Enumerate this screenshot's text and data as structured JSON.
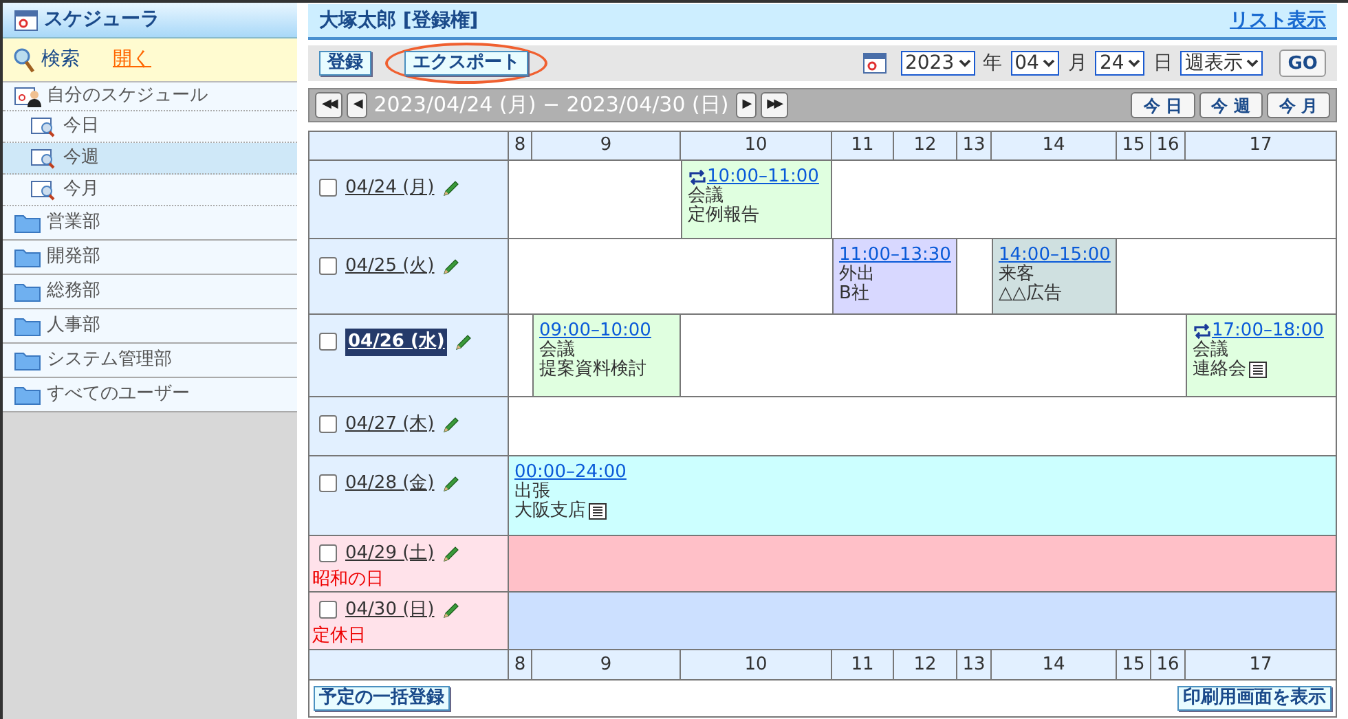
{
  "sidebar": {
    "title": "スケジューラ",
    "search_label": "検索",
    "open_label": "開く",
    "items": [
      {
        "label": "自分のスケジュール",
        "kind": "schedule",
        "children": [
          {
            "label": "今日",
            "selected": false
          },
          {
            "label": "今週",
            "selected": true
          },
          {
            "label": "今月",
            "selected": false
          }
        ]
      },
      {
        "label": "営業部",
        "kind": "folder"
      },
      {
        "label": "開発部",
        "kind": "folder"
      },
      {
        "label": "総務部",
        "kind": "folder"
      },
      {
        "label": "人事部",
        "kind": "folder"
      },
      {
        "label": "システム管理部",
        "kind": "folder"
      },
      {
        "label": "すべてのユーザー",
        "kind": "folder"
      }
    ]
  },
  "header": {
    "title": "大塚太郎 [登録権]",
    "list_link": "リスト表示"
  },
  "toolbar": {
    "buttons": [
      {
        "label": "登録",
        "highlighted": false
      },
      {
        "label": "エクスポート",
        "highlighted": true
      }
    ],
    "year": "2023",
    "year_unit": "年",
    "month": "04",
    "month_unit": "月",
    "day": "24",
    "day_unit": "日",
    "view": "週表示",
    "go": "GO"
  },
  "nav": {
    "first": "◀◀",
    "prev": "◀",
    "range": "2023/04/24 (月) − 2023/04/30 (日)",
    "next": "▶",
    "last": "▶▶",
    "buttons": [
      "今 日",
      "今 週",
      "今 月"
    ]
  },
  "grid": {
    "hours": [
      "8",
      "9",
      "10",
      "11",
      "12",
      "13",
      "14",
      "15",
      "16",
      "17"
    ],
    "footer_hours": [
      "8",
      "9",
      "10",
      "11",
      "12",
      "13",
      "14",
      "15",
      "16",
      "17"
    ],
    "days": [
      {
        "date": "04/24 (月)",
        "checked": false,
        "selected": false,
        "kind": "weekday",
        "events": [
          {
            "time": "10:00–11:00",
            "title": "会議",
            "note": "定例報告",
            "repeat": true,
            "color": "#e0ffe0"
          }
        ]
      },
      {
        "date": "04/25 (火)",
        "checked": false,
        "selected": false,
        "kind": "weekday",
        "events": [
          {
            "time": "11:00–13:30",
            "title": "外出",
            "note": "B社",
            "color": "#d8d8ff"
          },
          {
            "time": "14:00–15:00",
            "title": "来客",
            "note": "△△広告",
            "color": "#cfe0e0"
          }
        ]
      },
      {
        "date": "04/26 (水)",
        "checked": false,
        "selected": true,
        "kind": "weekday",
        "events": [
          {
            "time": "09:00–10:00",
            "title": "会議",
            "note": "提案資料検討",
            "color": "#e0ffe0"
          },
          {
            "time": "17:00–18:00",
            "title": "会議",
            "note": "連絡会",
            "repeat": true,
            "memo": true,
            "color": "#e0ffe0"
          }
        ]
      },
      {
        "date": "04/27 (木)",
        "checked": false,
        "selected": false,
        "kind": "weekday"
      },
      {
        "date": "04/28 (金)",
        "checked": false,
        "selected": false,
        "kind": "weekday",
        "events": [
          {
            "time": "00:00–24:00",
            "title": "出張",
            "note": "大阪支店",
            "memo": true,
            "color": "#ccffff"
          }
        ]
      },
      {
        "date": "04/29 (土)",
        "checked": false,
        "selected": false,
        "kind": "holiday",
        "holiday": "昭和の日"
      },
      {
        "date": "04/30 (日)",
        "checked": false,
        "selected": false,
        "kind": "closed",
        "holiday": "定休日"
      }
    ]
  },
  "footer": {
    "bulk_button": "予定の一括登録",
    "print_button": "印刷用画面を表示"
  }
}
